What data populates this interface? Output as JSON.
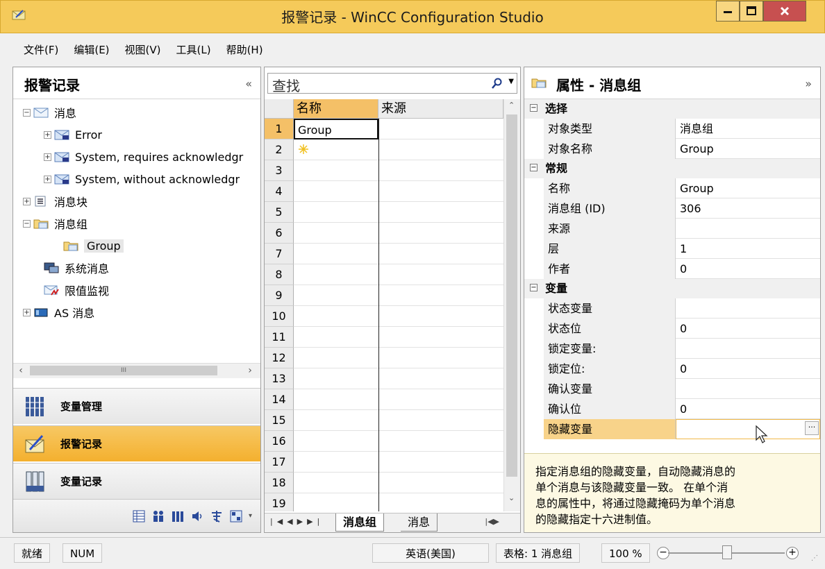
{
  "window": {
    "title": "报警记录 - WinCC Configuration Studio"
  },
  "menu": [
    "文件(F)",
    "编辑(E)",
    "视图(V)",
    "工具(L)",
    "帮助(H)"
  ],
  "left_panel": {
    "title": "报警记录",
    "collapse": "«",
    "tree": [
      "消息",
      "Error",
      "System, requires acknowledgr",
      "System, without acknowledgr",
      "消息块",
      "消息组",
      "Group",
      "系统消息",
      "限值监视",
      "AS 消息"
    ],
    "scroll_thumb": "III",
    "nav": [
      "变量管理",
      "报警记录",
      "变量记录"
    ]
  },
  "center_panel": {
    "search_placeholder": "查找",
    "columns": [
      "名称",
      "来源"
    ],
    "rows": [
      "1",
      "2",
      "3",
      "4",
      "5",
      "6",
      "7",
      "8",
      "9",
      "10",
      "11",
      "12",
      "13",
      "14",
      "15",
      "16",
      "17",
      "18",
      "19"
    ],
    "row1_name": "Group",
    "tabs": [
      "消息组",
      "消息"
    ]
  },
  "right_panel": {
    "title": "属性 - 消息组",
    "expand": "»",
    "categories": [
      "选择",
      "常规",
      "变量"
    ],
    "props": {
      "selection": [
        {
          "name": "对象类型",
          "value": "消息组"
        },
        {
          "name": "对象名称",
          "value": "Group"
        }
      ],
      "general": [
        {
          "name": "名称",
          "value": "Group"
        },
        {
          "name": "消息组 (ID)",
          "value": "306"
        },
        {
          "name": "来源",
          "value": ""
        },
        {
          "name": "层",
          "value": "1"
        },
        {
          "name": "作者",
          "value": "0"
        }
      ],
      "tags": [
        {
          "name": "状态变量",
          "value": ""
        },
        {
          "name": "状态位",
          "value": "0"
        },
        {
          "name": "锁定变量:",
          "value": ""
        },
        {
          "name": "锁定位:",
          "value": "0"
        },
        {
          "name": "确认变量",
          "value": ""
        },
        {
          "name": "确认位",
          "value": "0"
        },
        {
          "name": "隐藏变量",
          "value": ""
        }
      ]
    },
    "help_lines": [
      "指定消息组的隐藏变量，自动隐藏消息的",
      "单个消息与该隐藏变量一致。 在单个消",
      "息的属性中，将通过隐藏掩码为单个消息",
      "的隐藏指定十六进制值。"
    ]
  },
  "status_bar": {
    "ready": "就绪",
    "num": "NUM",
    "language": "英语(美国)",
    "table": "表格: 1 消息组",
    "zoom": "100 %"
  },
  "colors": {
    "title_bar": "#f5ca5a",
    "active_nav": "#f4b02e",
    "help_bg": "#fdf9e3"
  }
}
